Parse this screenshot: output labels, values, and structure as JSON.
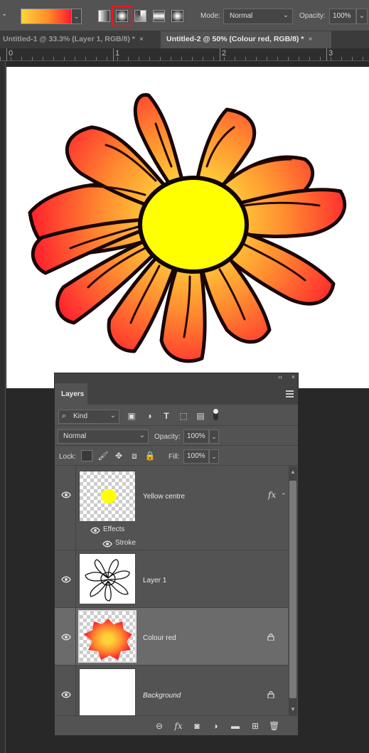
{
  "options_bar": {
    "gradient_preview_colors": [
      "#ffd43a",
      "#ff8a2a",
      "#ff1a2e"
    ],
    "gradient_types": [
      {
        "name": "linear-gradient-icon",
        "selected": false
      },
      {
        "name": "radial-gradient-icon",
        "selected": true
      },
      {
        "name": "angle-gradient-icon",
        "selected": false
      },
      {
        "name": "reflected-gradient-icon",
        "selected": false
      },
      {
        "name": "diamond-gradient-icon",
        "selected": false
      }
    ],
    "mode_label": "Mode:",
    "mode_value": "Normal",
    "opacity_label": "Opacity:",
    "opacity_value": "100%"
  },
  "tabs": [
    {
      "label": "Untitled-1 @ 33.3% (Layer 1, RGB/8) *",
      "close": "×",
      "active": false
    },
    {
      "label": "Untitled-2 @ 50% (Colour red, RGB/8) *",
      "close": "×",
      "active": true
    }
  ],
  "ruler": {
    "labels": [
      "0",
      "1",
      "2",
      "3"
    ]
  },
  "flower": {
    "petal_gradient_inner": "#ffc83a",
    "petal_gradient_outer": "#ff1c2e",
    "center_color": "#ffff00",
    "outline_color": "#1a0606"
  },
  "layers_panel": {
    "tab_label": "Layers",
    "collapse_glyph": "‹‹",
    "close_glyph": "×",
    "kind_label": "Kind",
    "blend_mode": "Normal",
    "opacity_label": "Opacity:",
    "opacity_value": "100%",
    "lock_label": "Lock:",
    "fill_label": "Fill:",
    "fill_value": "100%",
    "layers": [
      {
        "name": "Yellow centre",
        "has_fx": true,
        "fx_label": "fx",
        "effects_label": "Effects",
        "effect_items": [
          "Stroke"
        ]
      },
      {
        "name": "Layer 1"
      },
      {
        "name": "Colour red",
        "selected": true,
        "locked": true
      },
      {
        "name": "Background",
        "italic": true,
        "locked": true
      }
    ]
  }
}
